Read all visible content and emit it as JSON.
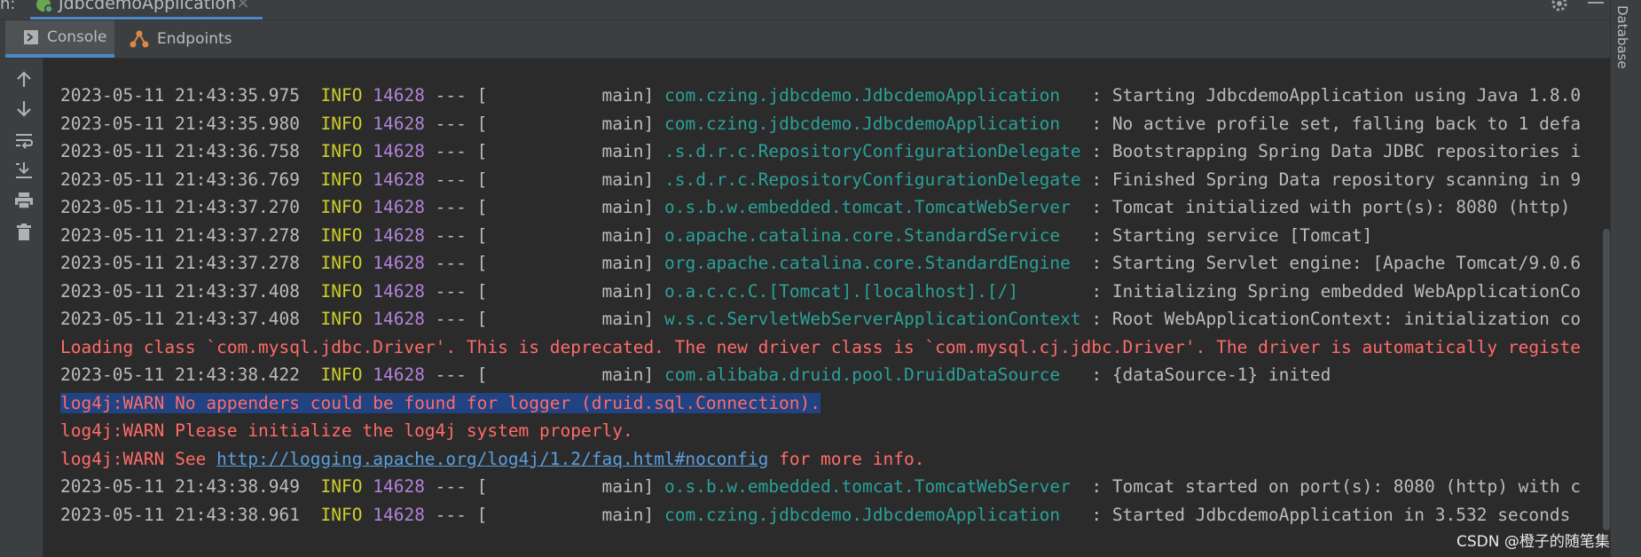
{
  "run_panel": {
    "prefix": "n:",
    "app_tab_label": "JdbcdemoApplication",
    "close_glyph": "×"
  },
  "tabs": [
    {
      "label": "Console",
      "icon": "console-icon",
      "active": true
    },
    {
      "label": "Endpoints",
      "icon": "endpoints-icon",
      "active": false
    }
  ],
  "toolbar_icons": [
    "arrow-up-icon",
    "arrow-down-icon",
    "soft-wrap-icon",
    "scroll-to-end-icon",
    "print-icon",
    "trash-icon"
  ],
  "right_strip": {
    "label": "Database"
  },
  "log_lines": [
    {
      "kind": "log",
      "ts": "2023-05-11 21:43:35.975",
      "level": "INFO",
      "pid": "14628",
      "sep": " --- [",
      "thread": "           main] ",
      "logger": "com.czing.jdbcdemo.JdbcdemoApplication  ",
      "msg": " : Starting JdbcdemoApplication using Java 1.8.0"
    },
    {
      "kind": "log",
      "ts": "2023-05-11 21:43:35.980",
      "level": "INFO",
      "pid": "14628",
      "sep": " --- [",
      "thread": "           main] ",
      "logger": "com.czing.jdbcdemo.JdbcdemoApplication  ",
      "msg": " : No active profile set, falling back to 1 defa"
    },
    {
      "kind": "log",
      "ts": "2023-05-11 21:43:36.758",
      "level": "INFO",
      "pid": "14628",
      "sep": " --- [",
      "thread": "           main] ",
      "logger": ".s.d.r.c.RepositoryConfigurationDelegate",
      "msg": " : Bootstrapping Spring Data JDBC repositories i"
    },
    {
      "kind": "log",
      "ts": "2023-05-11 21:43:36.769",
      "level": "INFO",
      "pid": "14628",
      "sep": " --- [",
      "thread": "           main] ",
      "logger": ".s.d.r.c.RepositoryConfigurationDelegate",
      "msg": " : Finished Spring Data repository scanning in 9"
    },
    {
      "kind": "log",
      "ts": "2023-05-11 21:43:37.270",
      "level": "INFO",
      "pid": "14628",
      "sep": " --- [",
      "thread": "           main] ",
      "logger": "o.s.b.w.embedded.tomcat.TomcatWebServer ",
      "msg": " : Tomcat initialized with port(s): 8080 (http)"
    },
    {
      "kind": "log",
      "ts": "2023-05-11 21:43:37.278",
      "level": "INFO",
      "pid": "14628",
      "sep": " --- [",
      "thread": "           main] ",
      "logger": "o.apache.catalina.core.StandardService  ",
      "msg": " : Starting service [Tomcat]"
    },
    {
      "kind": "log",
      "ts": "2023-05-11 21:43:37.278",
      "level": "INFO",
      "pid": "14628",
      "sep": " --- [",
      "thread": "           main] ",
      "logger": "org.apache.catalina.core.StandardEngine ",
      "msg": " : Starting Servlet engine: [Apache Tomcat/9.0.6"
    },
    {
      "kind": "log",
      "ts": "2023-05-11 21:43:37.408",
      "level": "INFO",
      "pid": "14628",
      "sep": " --- [",
      "thread": "           main] ",
      "logger": "o.a.c.c.C.[Tomcat].[localhost].[/]      ",
      "msg": " : Initializing Spring embedded WebApplicationCo"
    },
    {
      "kind": "log",
      "ts": "2023-05-11 21:43:37.408",
      "level": "INFO",
      "pid": "14628",
      "sep": " --- [",
      "thread": "           main] ",
      "logger": "w.s.c.ServletWebServerApplicationContext",
      "msg": " : Root WebApplicationContext: initialization co"
    },
    {
      "kind": "err",
      "text": "Loading class `com.mysql.jdbc.Driver'. This is deprecated. The new driver class is `com.mysql.cj.jdbc.Driver'. The driver is automatically registe"
    },
    {
      "kind": "log",
      "ts": "2023-05-11 21:43:38.422",
      "level": "INFO",
      "pid": "14628",
      "sep": " --- [",
      "thread": "           main] ",
      "logger": "com.alibaba.druid.pool.DruidDataSource  ",
      "msg": " : {dataSource-1} inited"
    },
    {
      "kind": "err-hl",
      "text": "log4j:WARN No appenders could be found for logger (druid.sql.Connection)."
    },
    {
      "kind": "err",
      "text": "log4j:WARN Please initialize the log4j system properly."
    },
    {
      "kind": "err-link",
      "pre": "log4j:WARN See ",
      "link": "http://logging.apache.org/log4j/1.2/faq.html#noconfig",
      "post": " for more info."
    },
    {
      "kind": "log",
      "ts": "2023-05-11 21:43:38.949",
      "level": "INFO",
      "pid": "14628",
      "sep": " --- [",
      "thread": "           main] ",
      "logger": "o.s.b.w.embedded.tomcat.TomcatWebServer ",
      "msg": " : Tomcat started on port(s): 8080 (http) with c"
    },
    {
      "kind": "log",
      "ts": "2023-05-11 21:43:38.961",
      "level": "INFO",
      "pid": "14628",
      "sep": " --- [",
      "thread": "           main] ",
      "logger": "com.czing.jdbcdemo.JdbcdemoApplication  ",
      "msg": " : Started JdbcdemoApplication in 3.532 seconds"
    }
  ],
  "watermark": "CSDN @橙子的随笔集",
  "colors": {
    "background": "#2b2b2b",
    "panel": "#3c3f41",
    "accent": "#4a88c7",
    "info_level": "#cdcd2c",
    "pid": "#b083d8",
    "logger": "#2aa198",
    "error_text": "#ff6b68",
    "selection": "#214283",
    "link": "#5a9fdf"
  }
}
